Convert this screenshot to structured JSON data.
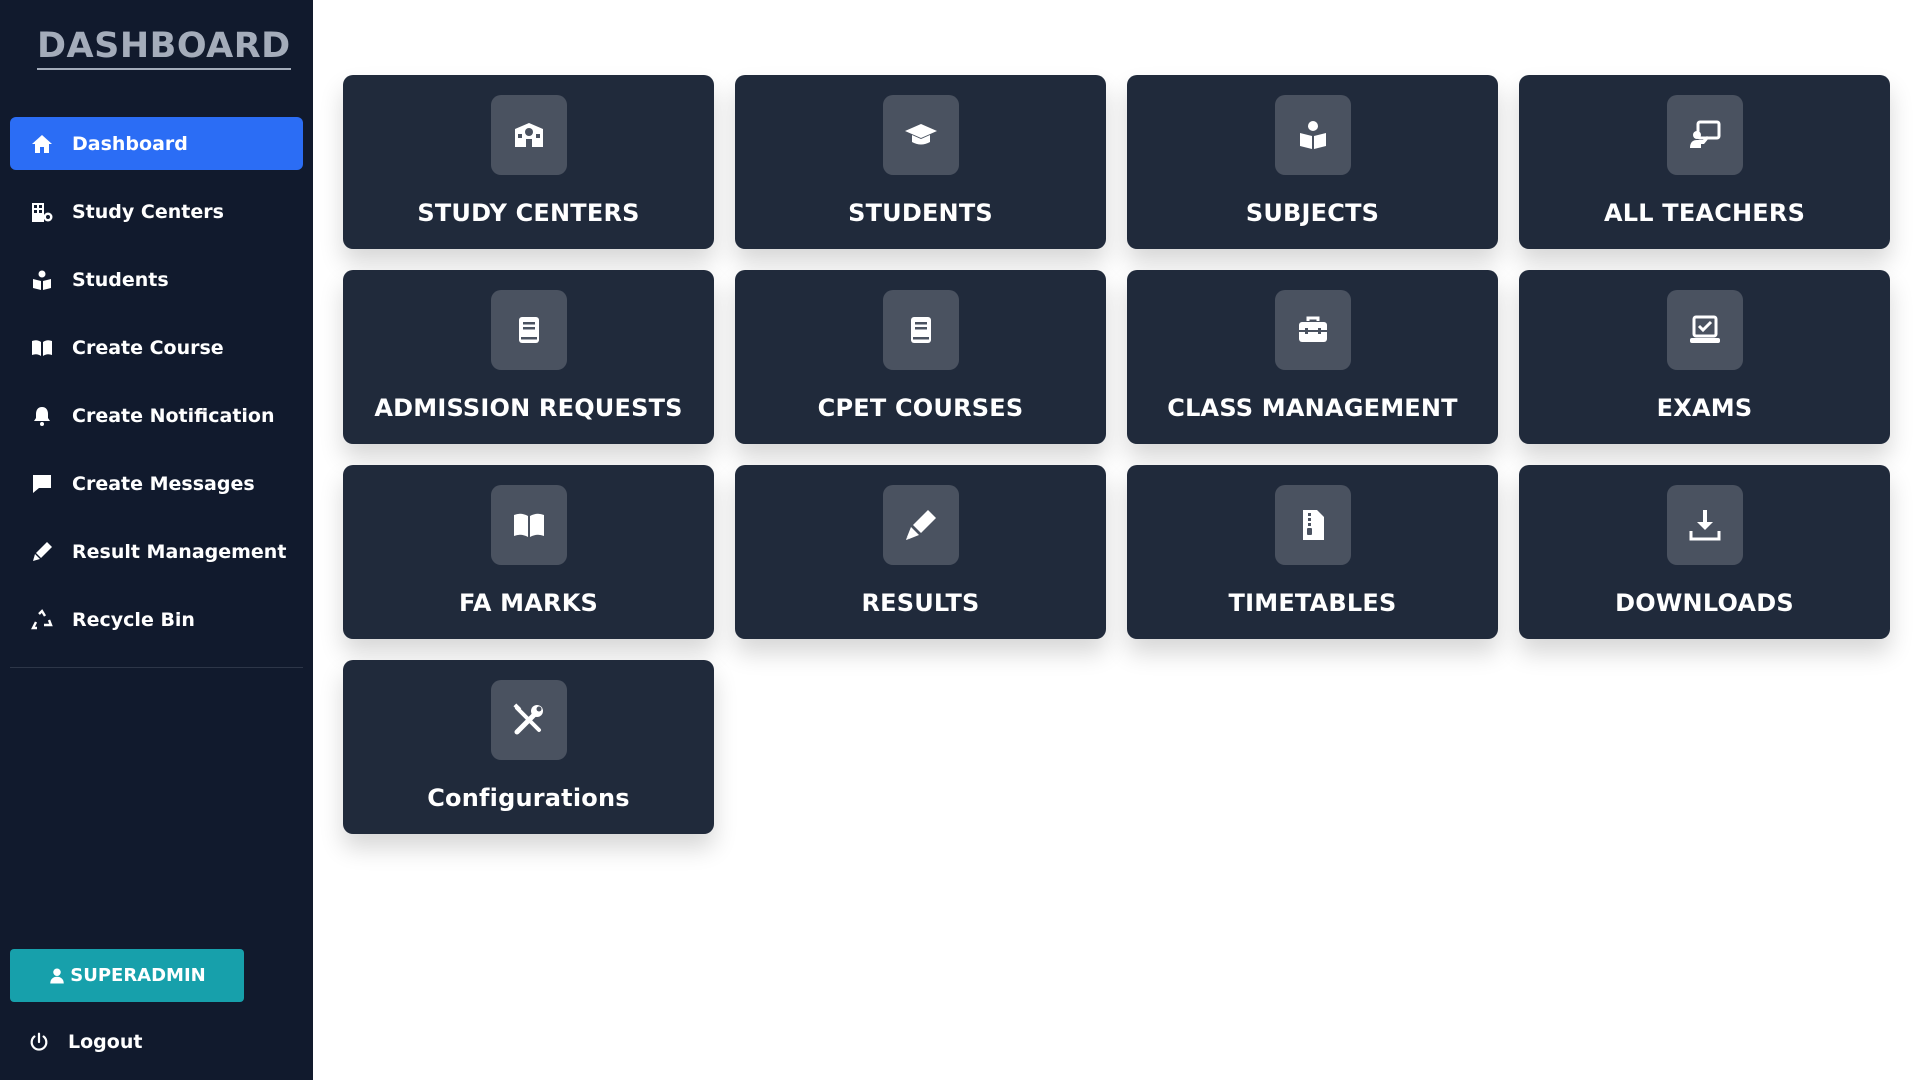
{
  "sidebar": {
    "brand": "DASHBOARD",
    "items": [
      {
        "label": "Dashboard",
        "icon": "home-icon",
        "active": true
      },
      {
        "label": "Study Centers",
        "icon": "building-icon",
        "active": false
      },
      {
        "label": "Students",
        "icon": "reader-icon",
        "active": false
      },
      {
        "label": "Create Course",
        "icon": "open-book-icon",
        "active": false
      },
      {
        "label": "Create Notification",
        "icon": "bell-icon",
        "active": false
      },
      {
        "label": "Create Messages",
        "icon": "message-icon",
        "active": false
      },
      {
        "label": "Result Management",
        "icon": "pen-icon",
        "active": false
      },
      {
        "label": "Recycle Bin",
        "icon": "recycle-icon",
        "active": false
      }
    ],
    "superadmin_label": "SUPERADMIN",
    "logout_label": "Logout"
  },
  "cards": [
    {
      "label": "STUDY CENTERS",
      "icon": "school-icon"
    },
    {
      "label": "STUDENTS",
      "icon": "graduation-cap-icon"
    },
    {
      "label": "SUBJECTS",
      "icon": "reader-icon"
    },
    {
      "label": "ALL TEACHERS",
      "icon": "teacher-icon"
    },
    {
      "label": "ADMISSION REQUESTS",
      "icon": "book-icon"
    },
    {
      "label": "CPET COURSES",
      "icon": "book-icon"
    },
    {
      "label": "CLASS MANAGEMENT",
      "icon": "toolbox-icon"
    },
    {
      "label": "EXAMS",
      "icon": "check-square-icon"
    },
    {
      "label": "FA MARKS",
      "icon": "open-book-icon"
    },
    {
      "label": "RESULTS",
      "icon": "marker-icon"
    },
    {
      "label": "TIMETABLES",
      "icon": "file-zipper-icon"
    },
    {
      "label": "DOWNLOADS",
      "icon": "download-icon"
    },
    {
      "label": "Configurations",
      "icon": "screwdriver-wrench-icon"
    }
  ],
  "colors": {
    "sidebar_bg": "#111a2d",
    "active_item": "#2b6df5",
    "card_bg": "#202a3b",
    "icon_tile": "#4a5260",
    "superadmin_bg": "#17a0ab",
    "brand_text": "#a4acba"
  }
}
